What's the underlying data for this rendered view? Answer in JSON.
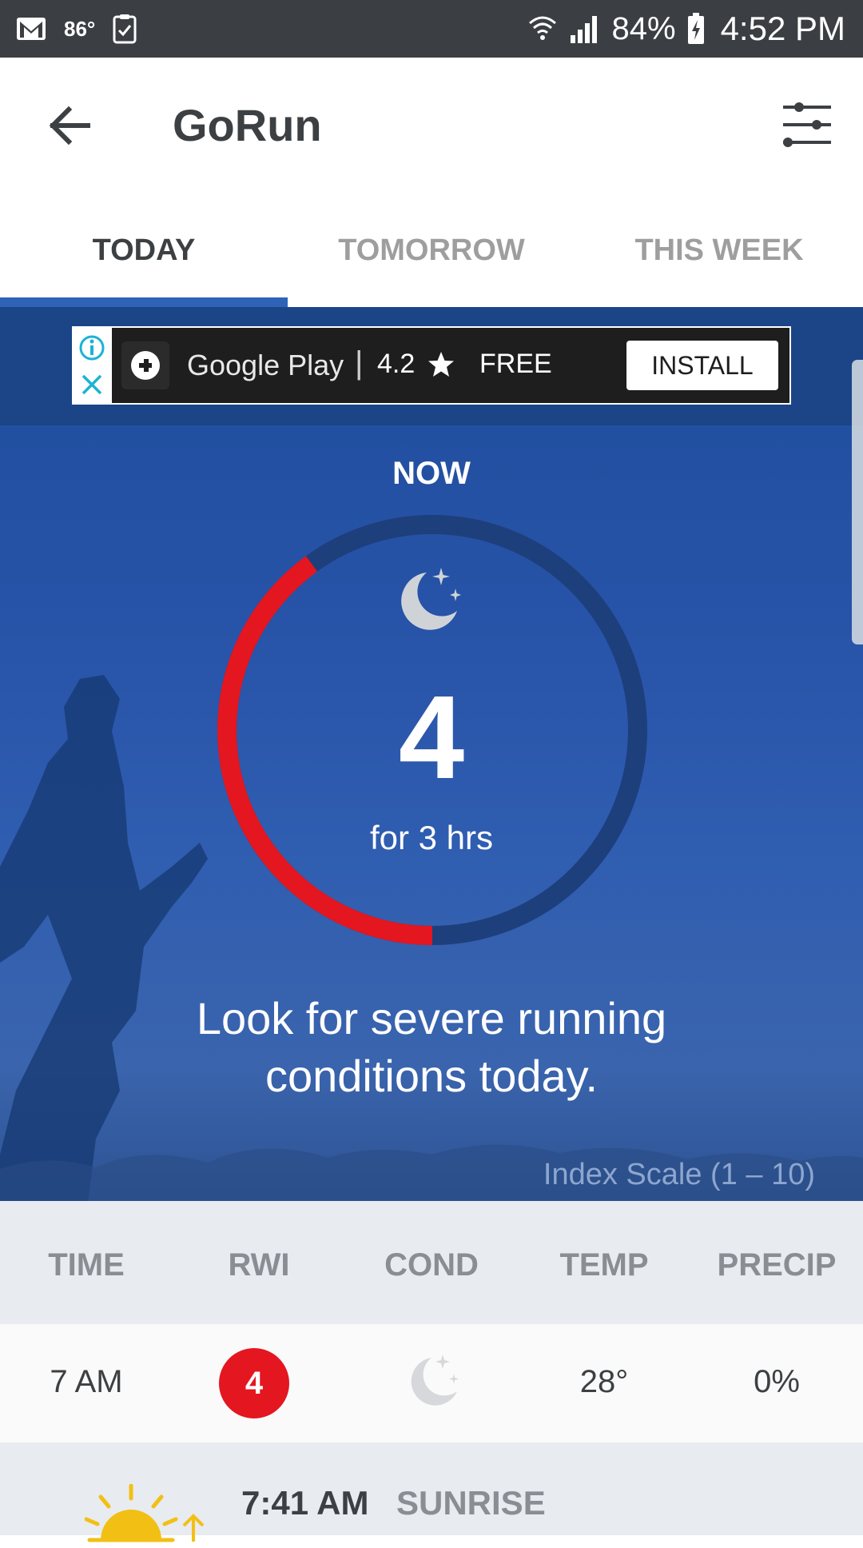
{
  "status_bar": {
    "temperature": "86°",
    "battery": "84%",
    "time": "4:52 PM"
  },
  "app_bar": {
    "title": "GoRun"
  },
  "tabs": [
    {
      "label": "TODAY",
      "active": true
    },
    {
      "label": "TOMORROW",
      "active": false
    },
    {
      "label": "THIS WEEK",
      "active": false
    }
  ],
  "ad": {
    "store": "Google Play",
    "separator": "|",
    "rating": "4.2",
    "price": "FREE",
    "cta": "INSTALL"
  },
  "hero": {
    "label": "NOW",
    "value": "4",
    "duration": "for 3 hrs",
    "gauge_fraction": 0.4,
    "message": "Look for severe running conditions today.",
    "scale_note": "Index Scale (1 – 10)",
    "accent_color": "#e41620"
  },
  "table": {
    "headers": [
      "TIME",
      "RWI",
      "COND",
      "TEMP",
      "PRECIP"
    ],
    "rows": [
      {
        "time": "7 AM",
        "rwi": "4",
        "cond": "moon-stars-icon",
        "temp": "28°",
        "precip": "0%"
      }
    ]
  },
  "sunrise": {
    "time": "7:41 AM",
    "label": "SUNRISE"
  }
}
